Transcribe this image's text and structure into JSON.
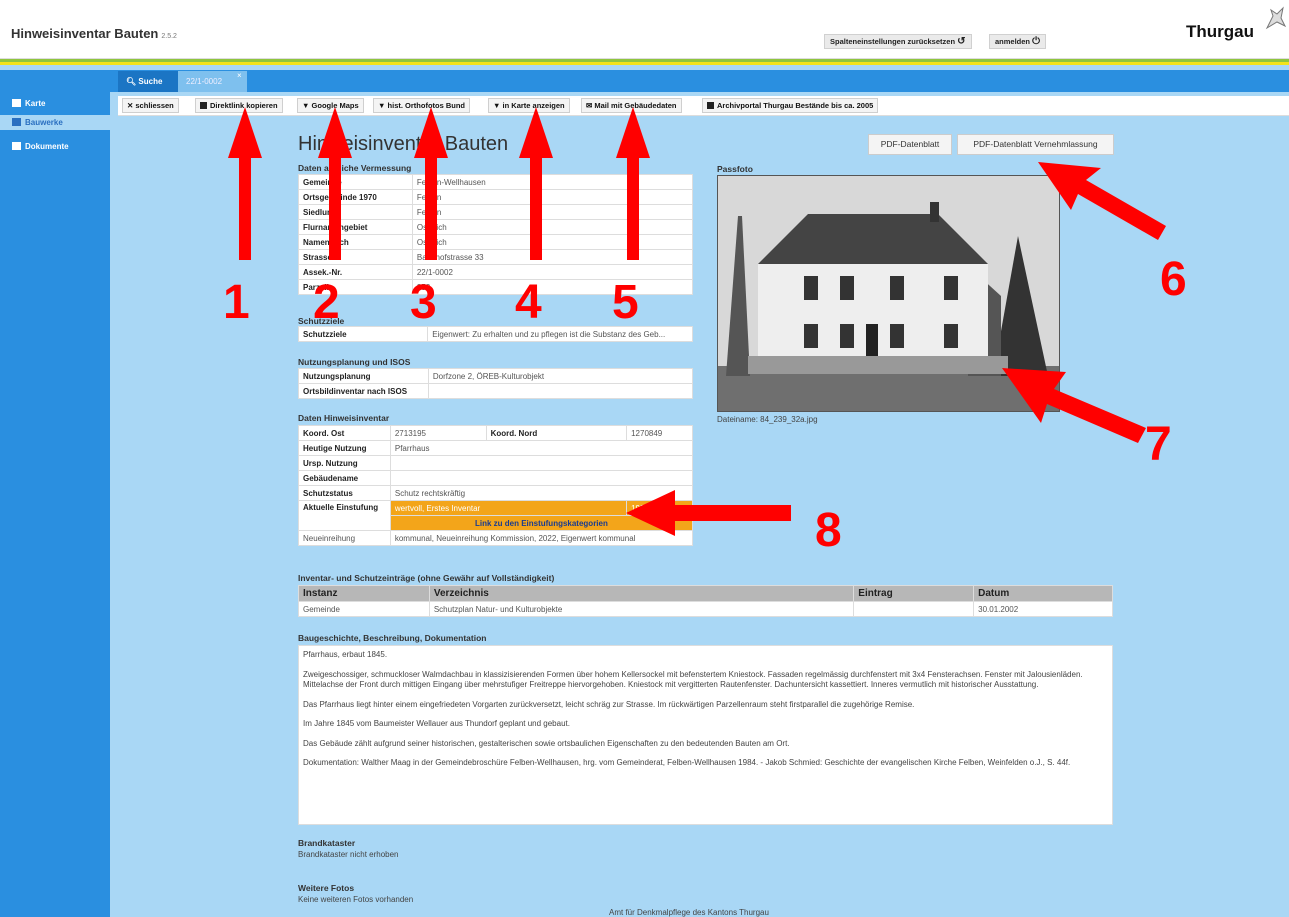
{
  "header": {
    "title": "Hinweisinventar Bauten",
    "version": "2.5.2",
    "reset_label": "Spalteneinstellungen zurücksetzen",
    "login_label": "anmelden",
    "logo": "Thurgau"
  },
  "sidebar": {
    "items": [
      {
        "label": "Karte",
        "icon": "map-icon"
      },
      {
        "label": "Bauwerke",
        "icon": "building-icon"
      },
      {
        "label": "Dokumente",
        "icon": "document-icon"
      }
    ]
  },
  "tabs": [
    {
      "label": "Suche",
      "icon": "search-icon"
    },
    {
      "label": "22/1-0002"
    }
  ],
  "toolbar": {
    "close": "schliessen",
    "copy_link": "Direktlink kopieren",
    "google_maps": "Google Maps",
    "ortho": "hist. Orthofotos Bund",
    "map": "in Karte anzeigen",
    "mail": "Mail mit Gebäudedaten",
    "archive": "Archivportal Thurgau Bestände bis ca. 2005"
  },
  "page": {
    "heading": "Hinweisinventar Bauten",
    "pdf": "PDF-Datenblatt",
    "pdf_vern": "PDF-Datenblatt Vernehmlassung"
  },
  "vermessung": {
    "title": "Daten amtliche Vermessung",
    "rows": [
      {
        "k": "Gemeinde",
        "v": "Felben-Wellhausen"
      },
      {
        "k": "Ortsgemeinde 1970",
        "v": "Felben"
      },
      {
        "k": "Siedlung",
        "v": "Felben"
      },
      {
        "k": "Flurnamengebiet",
        "v": "Ostreich"
      },
      {
        "k": "Namenbuch",
        "v": "Ostreich"
      },
      {
        "k": "Strasse",
        "v": "Bahnhofstrasse 33"
      },
      {
        "k": "Assek.-Nr.",
        "v": "22/1-0002"
      },
      {
        "k": "Parzelle",
        "v": "253"
      }
    ]
  },
  "schutzziele": {
    "title": "Schutzziele",
    "k": "Schutzziele",
    "v": "Eigenwert: Zu erhalten und zu pflegen ist die Substanz des Geb..."
  },
  "nutzung": {
    "title": "Nutzungsplanung und ISOS",
    "rows": [
      {
        "k": "Nutzungsplanung",
        "v": "Dorfzone 2, ÖREB-Kulturobjekt"
      },
      {
        "k": "Ortsbildinventar nach ISOS",
        "v": ""
      }
    ]
  },
  "hinweisinventar": {
    "title": "Daten Hinweisinventar",
    "koord_ost_k": "Koord. Ost",
    "koord_ost_v": "2713195",
    "koord_nord_k": "Koord. Nord",
    "koord_nord_v": "1270849",
    "rows": [
      {
        "k": "Heutige Nutzung",
        "v": "Pfarrhaus"
      },
      {
        "k": "Ursp. Nutzung",
        "v": ""
      },
      {
        "k": "Gebäudename",
        "v": ""
      },
      {
        "k": "Schutzstatus",
        "v": "Schutz rechtskräftig"
      }
    ],
    "einstufung_k": "Aktuelle Einstufung",
    "einstufung_v": "wertvoll, Erstes Inventar",
    "einstufung_year": "1996",
    "einstufung_link": "Link zu den Einstufungskategorien",
    "neu_k": "Neueinreihung",
    "neu_v": "kommunal, Neueinreihung Kommission, 2022, Eigenwert kommunal"
  },
  "passfoto": {
    "label": "Passfoto",
    "caption": "Dateiname: 84_239_32a.jpg"
  },
  "inventar": {
    "title": "Inventar- und Schutzeinträge (ohne Gewähr auf Vollständigkeit)",
    "headers": [
      "Instanz",
      "Verzeichnis",
      "Eintrag",
      "Datum"
    ],
    "rows": [
      [
        "Gemeinde",
        "Schutzplan Natur- und Kulturobjekte",
        "",
        "30.01.2002"
      ]
    ]
  },
  "baugeschichte": {
    "title": "Baugeschichte, Beschreibung, Dokumentation",
    "paragraphs": [
      "Pfarrhaus, erbaut 1845.",
      "Zweigeschossiger, schmuckloser Walmdachbau in klassizisierenden Formen über hohem Kellersockel mit befenstertem Kniestock. Fassaden regelmässig durchfenstert mit 3x4 Fensterachsen. Fenster mit Jalousienläden. Mittelachse der Front durch mittigen Eingang über mehrstufiger Freitreppe hiervorgehoben. Kniestock mit vergitterten Rautenfenster. Dachuntersicht kassettiert. Inneres vermutlich mit historischer Ausstattung.",
      "Das Pfarrhaus liegt hinter einem eingefriedeten Vorgarten zurückversetzt, leicht schräg zur Strasse. Im rückwärtigen Parzellenraum steht firstparallel die zugehörige Remise.",
      "Im Jahre 1845 vom Baumeister Wellauer aus Thundorf geplant und gebaut.",
      "Das Gebäude zählt aufgrund seiner historischen, gestalterischen sowie ortsbaulichen Eigenschaften zu den bedeutenden Bauten am Ort.",
      "Dokumentation: Walther Maag in der Gemeindebroschüre Felben-Wellhausen, hrg. vom Gemeinderat, Felben-Wellhausen 1984. - Jakob Schmied: Geschichte der evangelischen Kirche Felben, Weinfelden o.J., S. 44f."
    ]
  },
  "brandkataster": {
    "title": "Brandkataster",
    "text": "Brandkataster nicht erhoben"
  },
  "fotos": {
    "title": "Weitere Fotos",
    "text": "Keine weiteren Fotos vorhanden"
  },
  "footer": "Amt für Denkmalpflege des Kantons Thurgau",
  "annotations": [
    "1",
    "2",
    "3",
    "4",
    "5",
    "6",
    "7",
    "8"
  ],
  "colors": {
    "annotation": "#ff0000",
    "primary": "#2a8fe0",
    "background": "#a9d7f5",
    "highlight": "#f3a51a"
  }
}
